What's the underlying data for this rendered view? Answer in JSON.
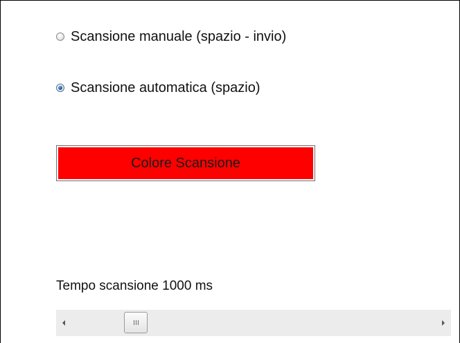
{
  "scan_mode": {
    "manual_label": "Scansione manuale (spazio - invio)",
    "automatic_label": "Scansione automatica (spazio)",
    "selected": "automatic"
  },
  "color_button": {
    "label": "Colore Scansione",
    "color": "#ff0000"
  },
  "scan_time": {
    "label": "Tempo scansione 1000 ms",
    "value_ms": 1000
  },
  "slider": {
    "left_arrow_icon": "triangle-left-icon",
    "right_arrow_icon": "triangle-right-icon",
    "thumb_icon": "grip-lines-icon"
  }
}
